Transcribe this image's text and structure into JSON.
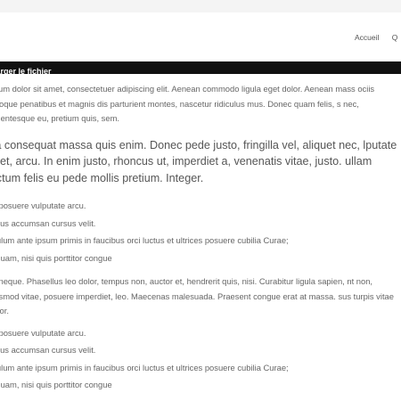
{
  "nav": {
    "items": [
      "Accueil",
      "Q"
    ]
  },
  "download_bar": {
    "label": "harger le fichier"
  },
  "content": {
    "para1": "ipsum dolor sit amet, consectetuer adipiscing elit. Aenean commodo ligula eget dolor. Aenean mass ociis natoque penatibus et magnis dis parturient montes, nascetur ridiculus mus. Donec quam felis, s nec, pellentesque eu, pretium quis, sem.",
    "lead": "illa consequat massa quis enim. Donec pede justo, fringilla vel, aliquet nec, lputate eget, arcu. In enim justo, rhoncus ut, imperdiet a, venenatis vitae, justo. ullam dictum felis eu pede mollis pretium. Integer.",
    "list1": [
      "ec posuere vulputate arcu.",
      "sellus accumsan cursus velit.",
      "tibulum ante ipsum primis in faucibus orci luctus et ultrices posuere cubilia Curae;",
      " aliquam, nisi quis porttitor congue"
    ],
    "para2": "ec neque. Phasellus leo dolor, tempus non, auctor et, hendrerit quis, nisi. Curabitur ligula sapien, nt non, euismod vitae, posuere imperdiet, leo. Maecenas malesuada. Praesent congue erat at massa. sus turpis vitae tortor.",
    "list2": [
      "ec posuere vulputate arcu.",
      "sellus accumsan cursus velit.",
      "tibulum ante ipsum primis in faucibus orci luctus et ultrices posuere cubilia Curae;",
      " aliquam, nisi quis porttitor congue"
    ]
  }
}
